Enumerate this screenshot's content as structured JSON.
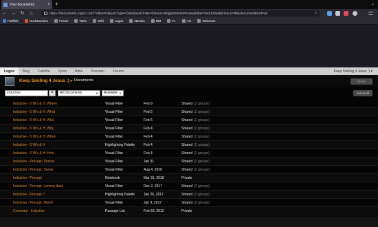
{
  "browser": {
    "tab_title": "Your documents",
    "tab_close": "×",
    "new_tab": "+",
    "tabs_menu": "⌄",
    "url": "https://documents.logos.com/?offset=0&sortType=Date&sortOrder=Descending&deleted=False&filter=Inductive&privacy=All&documentKind=all",
    "nav_icons": [
      "back-icon",
      "forward-icon",
      "reload-icon",
      "home-icon"
    ],
    "bookmarks": [
      {
        "label": "Faithlife",
        "color": "#4a7bd0"
      },
      {
        "label": "DuckDuckGo",
        "color": "#de5833"
      },
      {
        "label": "Forum",
        "color": "#8c8c96"
      },
      {
        "label": "ToDo",
        "color": "#8c8c96"
      },
      {
        "label": "Wiki",
        "color": "#8c8c96"
      },
      {
        "label": "Logos",
        "color": "#8c8c96"
      },
      {
        "label": "eBooks",
        "color": "#8c8c96"
      },
      {
        "label": "MM",
        "color": "#8c8c96"
      },
      {
        "label": "FL",
        "color": "#8c8c96"
      },
      {
        "label": "AG",
        "color": "#8c8c96"
      },
      {
        "label": "WebCam",
        "color": "#8c8c96"
      }
    ]
  },
  "site_nav": {
    "items": [
      "Logos",
      "Blog",
      "Faithlife",
      "Vyrso",
      "Bible",
      "Proclaim",
      "Forums"
    ],
    "active": "Logos",
    "user": "Keep Smiling 4 Jesus :) ▾"
  },
  "header": {
    "group_name": "Keep Smiling 4 Jesus :)",
    "group_arrow": "▸",
    "page_title": "Documents",
    "button_label": "Share"
  },
  "filters": {
    "search_value": "Inductive",
    "clear_label": "✕",
    "kind_select": "All Documents",
    "privacy_select": "Available",
    "select_all": "Select all"
  },
  "documents": [
    {
      "title": "Inductive - 5 W's & H: Where",
      "kind": "Visual Filter",
      "date": "Feb 9",
      "sharing": "Shared",
      "groups": "(2 groups)"
    },
    {
      "title": "Inductive - 5 W's & H: What",
      "kind": "Visual Filter",
      "date": "Feb 5",
      "sharing": "Shared",
      "groups": "(2 groups)"
    },
    {
      "title": "Inductive - 5 W's & H: Who",
      "kind": "Visual Filter",
      "date": "Feb 5",
      "sharing": "Shared",
      "groups": "(2 groups)"
    },
    {
      "title": "Inductive - 5 W's & H: Why",
      "kind": "Visual Filter",
      "date": "Feb 4",
      "sharing": "Shared",
      "groups": "(2 groups)"
    },
    {
      "title": "Inductive - 5 W's & H: When",
      "kind": "Visual Filter",
      "date": "Feb 4",
      "sharing": "Shared",
      "groups": "(2 groups)"
    },
    {
      "title": "Inductive - 5 W's & H",
      "kind": "Highlighting Palette",
      "date": "Feb 4",
      "sharing": "Shared",
      "groups": "(2 groups)"
    },
    {
      "title": "Inductive - 5 W's & H: How",
      "kind": "Visual Filter",
      "date": "Feb 4",
      "sharing": "Shared",
      "groups": "(2 groups)"
    },
    {
      "title": "Inductive - Precept: Person",
      "kind": "Visual Filter",
      "date": "Jan 31",
      "sharing": "Shared",
      "groups": "(2 groups)"
    },
    {
      "title": "Inductive - Precept: Sense",
      "kind": "Visual Filter",
      "date": "Aug 4, 2018",
      "sharing": "Shared",
      "groups": "(2 groups)"
    },
    {
      "title": "Inductive - Precept",
      "kind": "Notebook",
      "date": "Mar 31, 2018",
      "sharing": "Private",
      "groups": ""
    },
    {
      "title": "Inductive - Precept: Lemma lbsid",
      "kind": "Visual Filter",
      "date": "Dec 2, 2017",
      "sharing": "Shared",
      "groups": "(2 groups)"
    },
    {
      "title": "Inductive - Precept ?",
      "kind": "Highlighting Palette",
      "date": "Jan 26, 2017",
      "sharing": "Shared",
      "groups": "(2 groups)"
    },
    {
      "title": "Inductive - Precept: Morph",
      "kind": "Visual Filter",
      "date": "Jan 9, 2017",
      "sharing": "Shared",
      "groups": "(2 groups)"
    },
    {
      "title": "Covenant - Inductive",
      "kind": "Passage List",
      "date": "Feb 23, 2012",
      "sharing": "Private",
      "groups": ""
    }
  ]
}
